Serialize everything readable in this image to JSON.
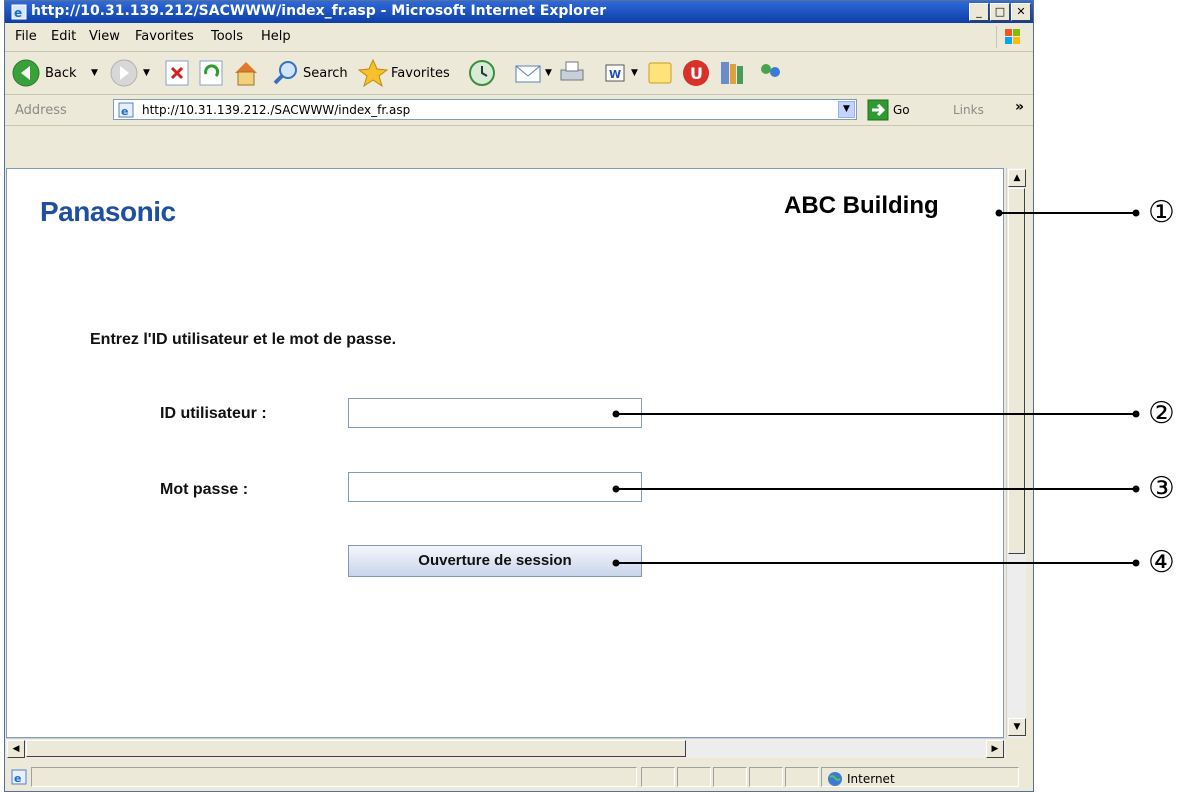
{
  "window": {
    "title": "http://10.31.139.212/SACWWW/index_fr.asp - Microsoft Internet Explorer",
    "min_glyph": "_",
    "max_glyph": "□",
    "close_glyph": "✕"
  },
  "menu": {
    "items": [
      {
        "label": "File"
      },
      {
        "label": "Edit"
      },
      {
        "label": "View"
      },
      {
        "label": "Favorites"
      },
      {
        "label": "Tools"
      },
      {
        "label": "Help"
      }
    ]
  },
  "toolbar": {
    "back_label": "Back",
    "search_label": "Search",
    "favorites_label": "Favorites"
  },
  "address": {
    "label": "Address",
    "url": "http://10.31.139.212./SACWWW/index_fr.asp",
    "go_label": "Go",
    "links_label": "Links",
    "more_glyph": "»"
  },
  "page": {
    "brand": "Panasonic",
    "building": "ABC Building",
    "instruction": "Entrez l'ID utilisateur et le mot de passe.",
    "user_id_label": "ID utilisateur :",
    "user_id_value": "",
    "password_label": "Mot passe :",
    "password_value": "",
    "login_button": "Ouverture de session"
  },
  "status": {
    "zone": "Internet"
  },
  "callouts": [
    "①",
    "②",
    "③",
    "④"
  ],
  "colors": {
    "brand_blue": "#1f4fa0",
    "titlebar": "#0c3ea6"
  }
}
